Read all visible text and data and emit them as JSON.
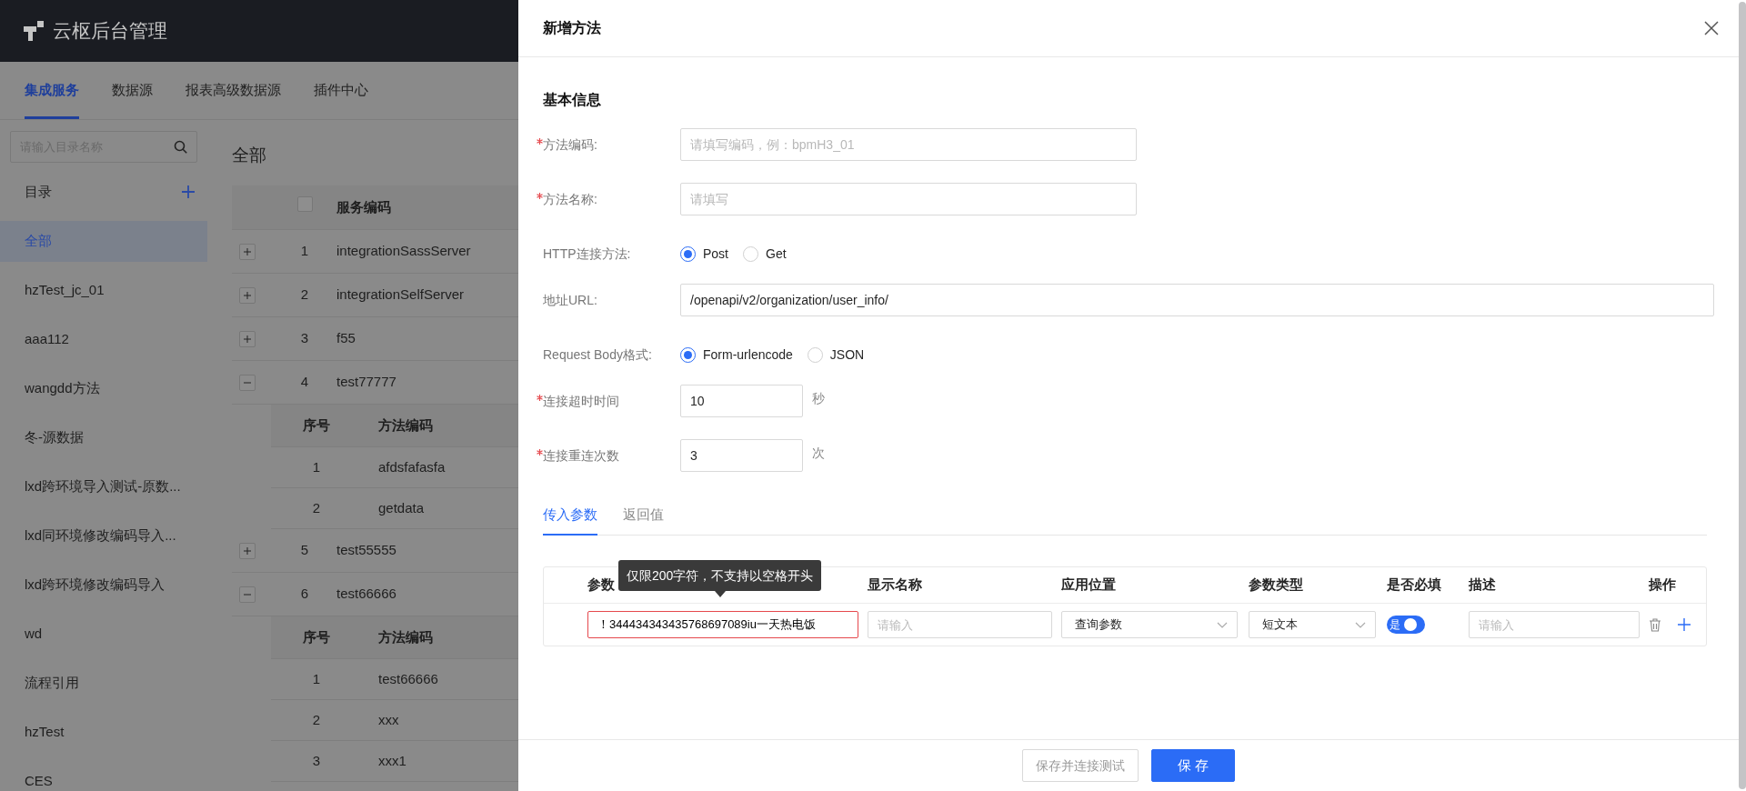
{
  "app": {
    "title": "云枢后台管理"
  },
  "top_tabs": [
    {
      "label": "集成服务",
      "selected": true
    },
    {
      "label": "数据源",
      "selected": false
    },
    {
      "label": "报表高级数据源",
      "selected": false
    },
    {
      "label": "插件中心",
      "selected": false
    }
  ],
  "sidebar": {
    "search_placeholder": "请输入目录名称",
    "heading": "目录",
    "items": [
      {
        "label": "全部",
        "selected": true
      },
      {
        "label": "hzTest_jc_01",
        "selected": false
      },
      {
        "label": "aaa112",
        "selected": false
      },
      {
        "label": "wangdd方法",
        "selected": false
      },
      {
        "label": "冬-源数据",
        "selected": false
      },
      {
        "label": "lxd跨环境导入测试-原数...",
        "selected": false
      },
      {
        "label": "lxd同环境修改编码导入...",
        "selected": false
      },
      {
        "label": "lxd跨环境修改编码导入",
        "selected": false
      },
      {
        "label": "wd",
        "selected": false
      },
      {
        "label": "流程引用",
        "selected": false
      },
      {
        "label": "hzTest",
        "selected": false
      },
      {
        "label": "CES",
        "selected": false
      }
    ]
  },
  "content": {
    "title": "全部",
    "table": {
      "select_all_checked": false,
      "columns": [
        "服务编码"
      ],
      "rows": [
        {
          "index": "1",
          "code": "integrationSassServer",
          "expanded": false
        },
        {
          "index": "2",
          "code": "integrationSelfServer",
          "expanded": false
        },
        {
          "index": "3",
          "code": "f55",
          "expanded": false
        },
        {
          "index": "4",
          "code": "test77777",
          "expanded": true,
          "methods": {
            "columns": [
              "序号",
              "方法编码"
            ],
            "rows": [
              {
                "index": "1",
                "code": "afdsfafasfa"
              },
              {
                "index": "2",
                "code": "getdata"
              }
            ]
          }
        },
        {
          "index": "5",
          "code": "test55555",
          "expanded": false
        },
        {
          "index": "6",
          "code": "test66666",
          "expanded": true,
          "methods": {
            "columns": [
              "序号",
              "方法编码"
            ],
            "rows": [
              {
                "index": "1",
                "code": "test66666"
              },
              {
                "index": "2",
                "code": "xxx"
              },
              {
                "index": "3",
                "code": "xxx1"
              }
            ]
          }
        }
      ]
    }
  },
  "drawer": {
    "title": "新增方法",
    "section": "基本信息",
    "fields": [
      {
        "kind": "text",
        "label": "方法编码:",
        "required": true,
        "placeholder": "请填写编码，例：bpmH3_01"
      },
      {
        "kind": "text",
        "label": "方法名称:",
        "required": true,
        "placeholder": "请填写"
      },
      {
        "kind": "radio",
        "label": "HTTP连接方法:",
        "required": false,
        "options": [
          {
            "label": "Post",
            "selected": true
          },
          {
            "label": "Get",
            "selected": false
          }
        ]
      },
      {
        "kind": "wide",
        "label": "地址URL:",
        "required": false,
        "value": "/openapi/v2/organization/user_info/"
      },
      {
        "kind": "radio",
        "label": "Request Body格式:",
        "required": false,
        "options": [
          {
            "label": "Form-urlencode",
            "selected": true
          },
          {
            "label": "JSON",
            "selected": false
          }
        ]
      },
      {
        "kind": "number",
        "label": "连接超时时间",
        "required": true,
        "value": "10",
        "unit": "秒"
      },
      {
        "kind": "number",
        "label": "连接重连次数",
        "required": true,
        "value": "3",
        "unit": "次"
      }
    ],
    "param_tabs": [
      {
        "label": "传入参数",
        "selected": true
      },
      {
        "label": "返回值",
        "selected": false
      }
    ],
    "params": {
      "columns": [
        "参数",
        "显示名称",
        "应用位置",
        "参数类型",
        "是否必填",
        "描述",
        "操作"
      ],
      "rows": [
        {
          "name": "！344434343435768697089iu一天热电饭",
          "name_error": true,
          "display_placeholder": "请输入",
          "position": "查询参数",
          "type": "短文本",
          "required_text": "是",
          "required_on": true,
          "desc_placeholder": "请输入"
        }
      ]
    },
    "tooltip": "仅限200字符，不支持以空格开头",
    "buttons": [
      {
        "label": "保存并连接测试",
        "kind": "secondary"
      },
      {
        "label": "保 存",
        "kind": "primary"
      }
    ]
  }
}
